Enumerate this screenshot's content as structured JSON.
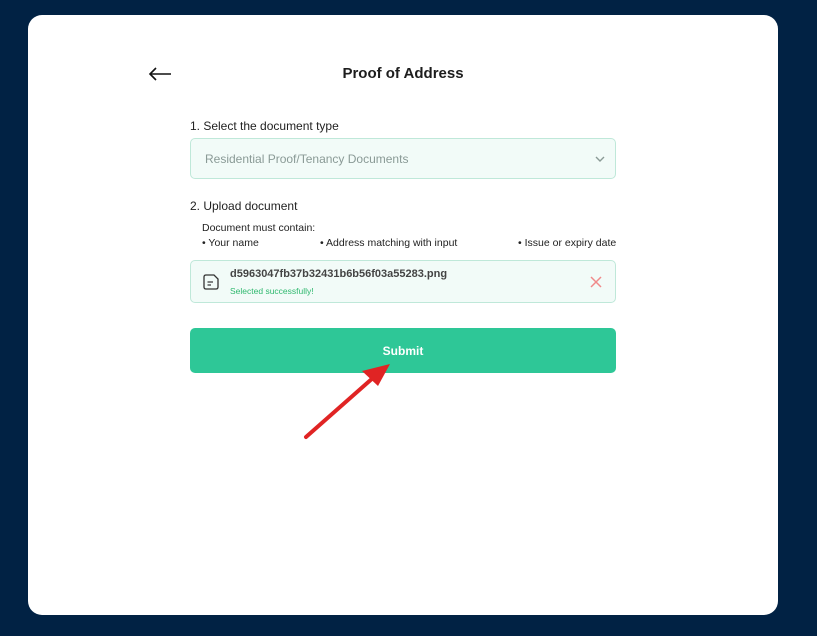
{
  "header": {
    "title": "Proof of Address",
    "back_icon": "arrow-left-icon"
  },
  "step1": {
    "label": "1. Select the document type",
    "selected_value": "Residential Proof/Tenancy Documents"
  },
  "step2": {
    "label": "2. Upload document",
    "requirements_title": "Document must contain:",
    "requirements": [
      "• Your name",
      "• Address matching with input",
      "• Issue or expiry date"
    ]
  },
  "file": {
    "name": "d5963047fb37b32431b6b56f03a55283.png",
    "status": "Selected successfully!"
  },
  "submit_label": "Submit",
  "colors": {
    "background": "#012244",
    "accent": "#2ec797",
    "success_text": "#2fb86e",
    "remove_icon": "#f08a8a",
    "annotation_arrow": "#e02424"
  }
}
